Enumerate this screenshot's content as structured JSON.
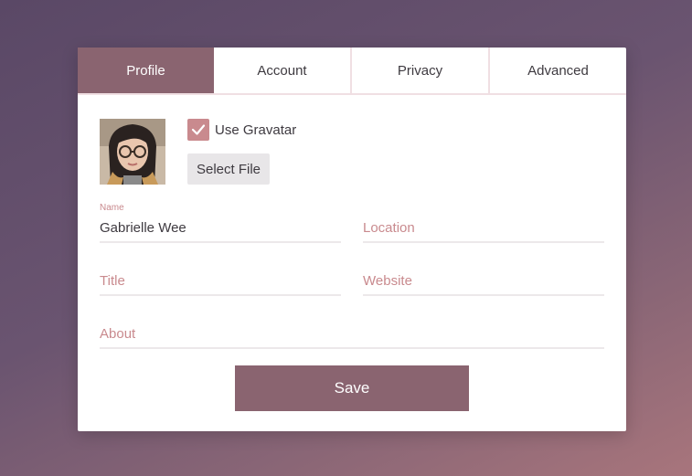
{
  "tabs": [
    {
      "label": "Profile",
      "active": true
    },
    {
      "label": "Account",
      "active": false
    },
    {
      "label": "Privacy",
      "active": false
    },
    {
      "label": "Advanced",
      "active": false
    }
  ],
  "avatar": {
    "icon": "user-photo"
  },
  "gravatar": {
    "label": "Use Gravatar",
    "checked": true
  },
  "select_file": {
    "label": "Select File"
  },
  "fields": {
    "name": {
      "label": "Name",
      "value": "Gabrielle Wee"
    },
    "location": {
      "placeholder": "Location",
      "value": ""
    },
    "title": {
      "placeholder": "Title",
      "value": ""
    },
    "website": {
      "placeholder": "Website",
      "value": ""
    },
    "about": {
      "placeholder": "About",
      "value": ""
    }
  },
  "save": {
    "label": "Save"
  },
  "colors": {
    "accent": "#8a6470",
    "checkbox": "#c98a8e",
    "placeholder": "#c98a8e"
  }
}
